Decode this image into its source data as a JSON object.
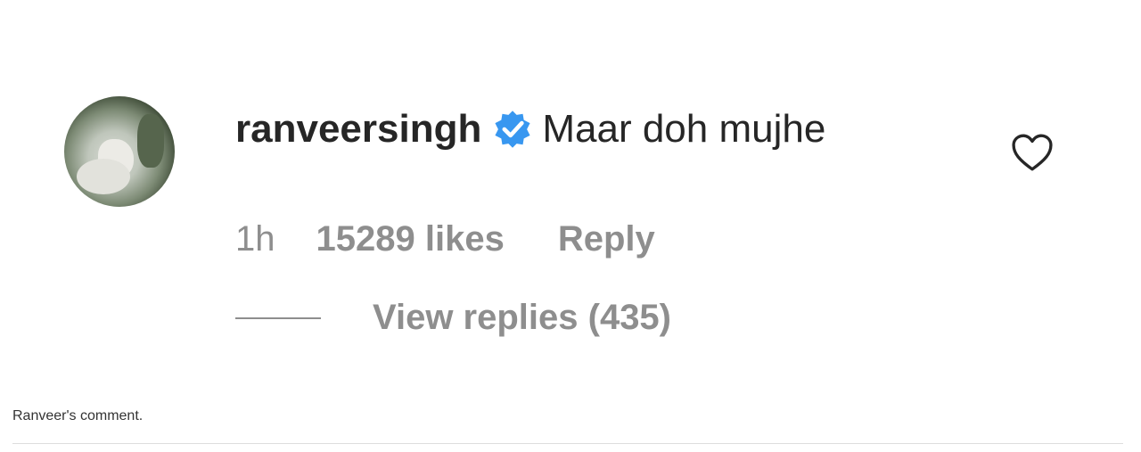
{
  "top_text_fragment": "",
  "comment": {
    "username": "ranveersingh",
    "verified": true,
    "text": "Maar doh mujhe",
    "time": "1h",
    "likes": "15289 likes",
    "reply_label": "Reply",
    "view_replies": "View replies (435)",
    "icons": {
      "avatar": "profile-photo",
      "verified": "verified-badge-icon",
      "like": "heart-outline-icon"
    },
    "colors": {
      "primary_text": "#262626",
      "secondary_text": "#8e8e8e",
      "verified": "#3897f0"
    }
  },
  "caption": "Ranveer's comment."
}
